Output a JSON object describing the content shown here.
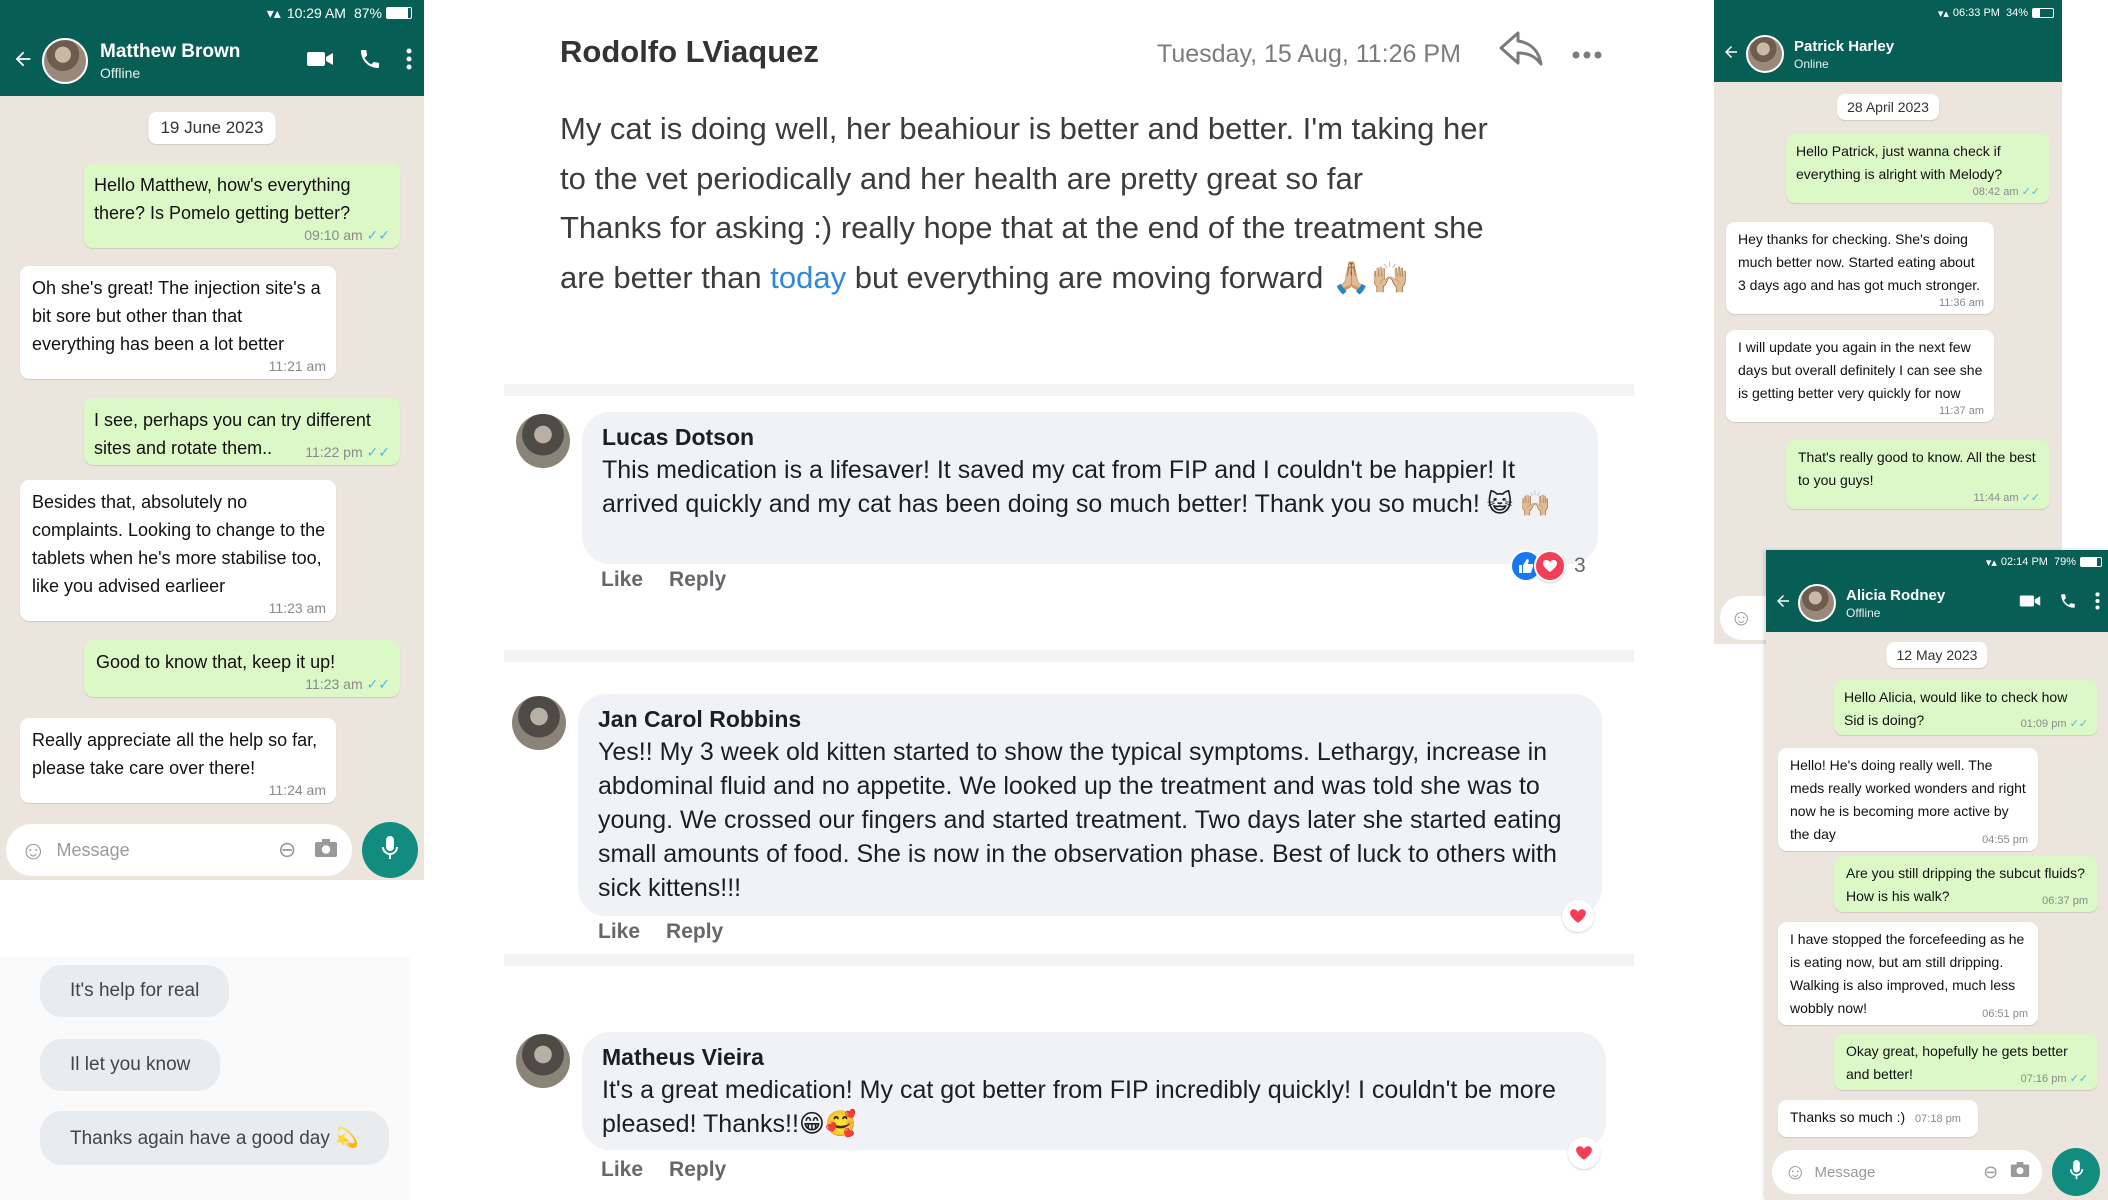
{
  "chat_matthew": {
    "status": {
      "time": "10:29 AM",
      "battery": "87%"
    },
    "contact": {
      "name": "Matthew Brown",
      "status": "Offline"
    },
    "date": "19 June 2023",
    "messages": [
      {
        "dir": "out",
        "text": "Hello Matthew, how's everything there? Is Pomelo getting better?",
        "time": "09:10 am"
      },
      {
        "dir": "in",
        "text": "Oh she's great! The injection site's a bit sore but other than that everything has been a lot better",
        "time": "11:21 am"
      },
      {
        "dir": "out",
        "text": "I see, perhaps you can try different sites and rotate them..",
        "time": "11:22 pm"
      },
      {
        "dir": "in",
        "text": "Besides that, absolutely no complaints. Looking to change to the tablets when he's more stabilise too, like you advised earlieer",
        "time": "11:23 am"
      },
      {
        "dir": "out",
        "text": "Good to know that, keep it up!",
        "time": "11:23 am"
      },
      {
        "dir": "in",
        "text": "Really appreciate all the help so far, please take care over there!",
        "time": "11:24 am"
      }
    ],
    "input_placeholder": "Message"
  },
  "quick_replies": [
    "It's help for real",
    "Il let you know",
    "Thanks again have a good day 💫"
  ],
  "post": {
    "author": "Rodolfo LViaquez",
    "date": "Tuesday, 15 Aug, 11:26 PM",
    "body_line1": "My cat is doing well, her beahiour is better and better. I'm taking her",
    "body_line2": "to the vet periodically and her health are pretty great so far",
    "body_line3": "Thanks for asking :) really hope that at the end of the treatment she",
    "body_line4_pre": "are better than ",
    "body_line4_link": "today",
    "body_line4_post": " but everything are moving forward 🙏🏼🙌🏼"
  },
  "comments": [
    {
      "name": "Lucas Dotson",
      "text": "This medication is a lifesaver! It saved my cat from FIP and I couldn't be happier! It arrived quickly and my cat has been doing so much better! Thank you so much! 😺 🙌🏼",
      "like": "Like",
      "reply": "Reply",
      "reaction_count": "3"
    },
    {
      "name": "Jan Carol Robbins",
      "text": "Yes!! My 3 week old kitten started to show the typical symptoms. Lethargy, increase in abdominal fluid and no appetite. We looked up the treatment and was told she was to young. We crossed our fingers and started treatment. Two days later she started eating small amounts of food. She is now in the observation phase. Best of luck to others with sick kittens!!!",
      "like": "Like",
      "reply": "Reply"
    },
    {
      "name": "Matheus Vieira",
      "text": "It's a great medication! My cat got better from FIP incredibly quickly! I couldn't be more pleased! Thanks!!😁🥰",
      "like": "Like",
      "reply": "Reply"
    }
  ],
  "chat_patrick": {
    "status": {
      "time": "06:33 PM",
      "battery": "34%"
    },
    "contact": {
      "name": "Patrick Harley",
      "status": "Online"
    },
    "date": "28 April 2023",
    "messages": [
      {
        "dir": "out",
        "text": "Hello Patrick, just wanna check if everything is alright with Melody?",
        "time": "08:42 am"
      },
      {
        "dir": "in",
        "text": "Hey thanks for checking. She's doing much better now. Started eating about 3 days ago and has got much stronger.",
        "time": "11:36 am"
      },
      {
        "dir": "in",
        "text": "I will update you again in the next few days but overall definitely I can see she is getting better very quickly for now",
        "time": "11:37 am"
      },
      {
        "dir": "out",
        "text": "That's really good to know. All the best to you guys!",
        "time": "11:44 am"
      }
    ]
  },
  "chat_alicia": {
    "status": {
      "time": "02:14 PM",
      "battery": "79%"
    },
    "contact": {
      "name": "Alicia Rodney",
      "status": "Offline"
    },
    "date": "12 May 2023",
    "messages": [
      {
        "dir": "out",
        "text": "Hello Alicia, would like to check how Sid is doing?",
        "time": "01:09 pm"
      },
      {
        "dir": "in",
        "text": "Hello! He's doing really well. The meds really worked wonders and right now he is becoming more active by the day",
        "time": "04:55 pm"
      },
      {
        "dir": "out",
        "text": "Are you still dripping the subcut fluids? How is his walk?",
        "time": "06:37 pm"
      },
      {
        "dir": "in",
        "text": "I have stopped the forcefeeding as he is eating now, but am still dripping. Walking is also improved, much less wobbly now!",
        "time": "06:51 pm"
      },
      {
        "dir": "out",
        "text": "Okay great, hopefully he gets better and better!",
        "time": "07:16 pm"
      },
      {
        "dir": "in",
        "text": "Thanks so much :)",
        "time": "07:18 pm"
      }
    ],
    "input_placeholder": "Message"
  },
  "icons": [
    "back-arrow-icon",
    "video-call-icon",
    "phone-icon",
    "more-vert-icon",
    "emoji-icon",
    "attach-icon",
    "camera-icon",
    "mic-icon",
    "reply-arrow-icon",
    "more-horiz-icon",
    "heart-icon",
    "like-icon"
  ],
  "colors": {
    "wa_header": "#075E54",
    "wa_outgoing": "#DCF8C6",
    "wa_background": "#ECE5DD",
    "link_blue": "#2f88d8",
    "heart_red": "#f33e58",
    "mic_green": "#128C7E"
  }
}
